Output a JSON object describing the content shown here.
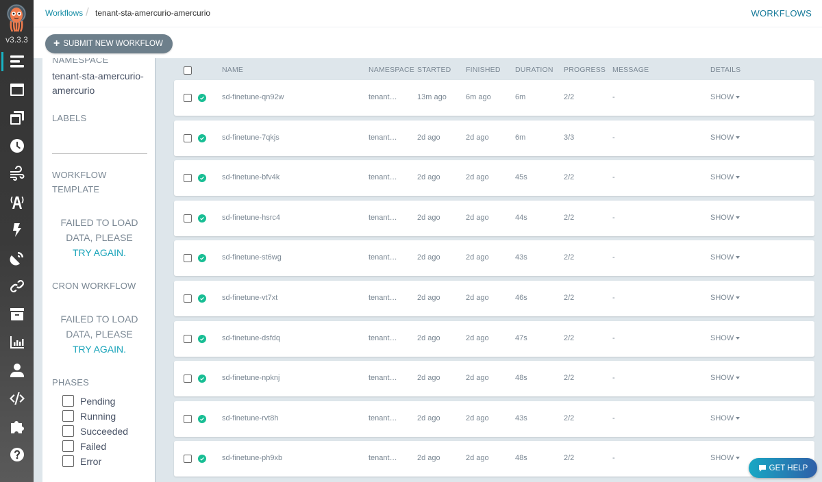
{
  "app": {
    "version": "v3.3.3",
    "brand_color": "#18b3c4"
  },
  "nav": {
    "items": [
      {
        "icon": "workflows-list-icon",
        "active": true
      },
      {
        "icon": "window-icon",
        "active": false
      },
      {
        "icon": "clone-icon",
        "active": false
      },
      {
        "icon": "clock-icon",
        "active": false
      },
      {
        "icon": "wind-icon",
        "active": false
      },
      {
        "icon": "broadcast-tower-icon",
        "active": false
      },
      {
        "icon": "bolt-icon",
        "active": false
      },
      {
        "icon": "satellite-dish-icon",
        "active": false
      },
      {
        "icon": "link-icon",
        "active": false
      },
      {
        "icon": "archive-icon",
        "active": false
      },
      {
        "icon": "chart-bar-icon",
        "active": false
      },
      {
        "icon": "user-icon",
        "active": false
      },
      {
        "icon": "code-icon",
        "active": false
      },
      {
        "icon": "puzzle-piece-icon",
        "active": false
      },
      {
        "icon": "question-circle-icon",
        "active": false
      }
    ]
  },
  "topbar": {
    "breadcrumb_root": "Workflows",
    "breadcrumb_current": "tenant-sta-amercurio-amercurio",
    "page_title": "WORKFLOWS"
  },
  "actions": {
    "submit_label": "SUBMIT NEW WORKFLOW"
  },
  "filters": {
    "namespace_label": "NAMESPACE",
    "namespace_value": "tenant-sta-amercurio-amercurio",
    "labels_label": "LABELS",
    "workflow_template_label": "WORKFLOW TEMPLATE",
    "cron_workflow_label": "CRON WORKFLOW",
    "error_text": "FAILED TO LOAD DATA, PLEASE",
    "retry_text": "TRY AGAIN.",
    "phases_label": "PHASES",
    "phases": [
      "Pending",
      "Running",
      "Succeeded",
      "Failed",
      "Error"
    ]
  },
  "table": {
    "headers": {
      "name": "NAME",
      "namespace": "NAMESPACE",
      "started": "STARTED",
      "finished": "FINISHED",
      "duration": "DURATION",
      "progress": "PROGRESS",
      "message": "MESSAGE",
      "details": "DETAILS"
    },
    "status_color": "#18be94",
    "show_label": "SHOW",
    "rows": [
      {
        "name": "sd-finetune-qn92w",
        "namespace": "tenant…",
        "started": "13m ago",
        "finished": "6m ago",
        "duration": "6m",
        "progress": "2/2",
        "message": "-",
        "status": "Succeeded"
      },
      {
        "name": "sd-finetune-7qkjs",
        "namespace": "tenant…",
        "started": "2d ago",
        "finished": "2d ago",
        "duration": "6m",
        "progress": "3/3",
        "message": "-",
        "status": "Succeeded"
      },
      {
        "name": "sd-finetune-bfv4k",
        "namespace": "tenant…",
        "started": "2d ago",
        "finished": "2d ago",
        "duration": "45s",
        "progress": "2/2",
        "message": "-",
        "status": "Succeeded"
      },
      {
        "name": "sd-finetune-hsrc4",
        "namespace": "tenant…",
        "started": "2d ago",
        "finished": "2d ago",
        "duration": "44s",
        "progress": "2/2",
        "message": "-",
        "status": "Succeeded"
      },
      {
        "name": "sd-finetune-st6wg",
        "namespace": "tenant…",
        "started": "2d ago",
        "finished": "2d ago",
        "duration": "43s",
        "progress": "2/2",
        "message": "-",
        "status": "Succeeded"
      },
      {
        "name": "sd-finetune-vt7xt",
        "namespace": "tenant…",
        "started": "2d ago",
        "finished": "2d ago",
        "duration": "46s",
        "progress": "2/2",
        "message": "-",
        "status": "Succeeded"
      },
      {
        "name": "sd-finetune-dsfdq",
        "namespace": "tenant…",
        "started": "2d ago",
        "finished": "2d ago",
        "duration": "47s",
        "progress": "2/2",
        "message": "-",
        "status": "Succeeded"
      },
      {
        "name": "sd-finetune-npknj",
        "namespace": "tenant…",
        "started": "2d ago",
        "finished": "2d ago",
        "duration": "48s",
        "progress": "2/2",
        "message": "-",
        "status": "Succeeded"
      },
      {
        "name": "sd-finetune-rvt8h",
        "namespace": "tenant…",
        "started": "2d ago",
        "finished": "2d ago",
        "duration": "43s",
        "progress": "2/2",
        "message": "-",
        "status": "Succeeded"
      },
      {
        "name": "sd-finetune-ph9xb",
        "namespace": "tenant…",
        "started": "2d ago",
        "finished": "2d ago",
        "duration": "48s",
        "progress": "2/2",
        "message": "-",
        "status": "Succeeded"
      }
    ]
  },
  "help": {
    "label": "GET HELP"
  }
}
